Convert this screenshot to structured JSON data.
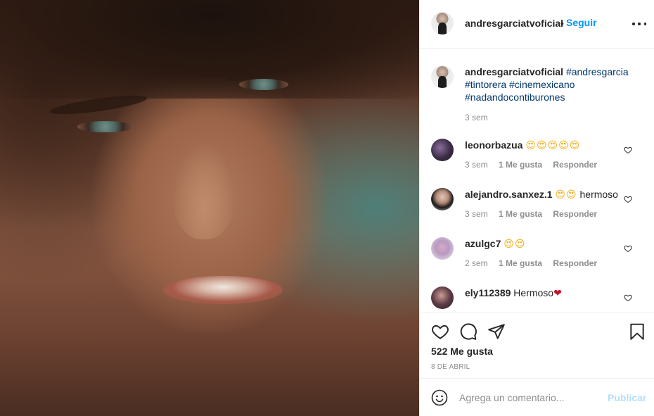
{
  "post": {
    "image_alt": "Close-up portrait of a man"
  },
  "header": {
    "username": "andresgarciatvoficial",
    "separator": "•",
    "follow_label": "Seguir"
  },
  "caption": {
    "username": "andresgarciatvoficial",
    "hashtags": [
      "#andresgarcia",
      "#tintorera",
      "#cinemexicano",
      "#nadandocontiburones"
    ],
    "time": "3 sem"
  },
  "comments": [
    {
      "username": "leonorbazua",
      "text": "",
      "emoji": "😍😍😍😍😍",
      "time": "3 sem",
      "likes": "1 Me gusta",
      "reply": "Responder"
    },
    {
      "username": "alejandro.sanxez.1",
      "text": "hermoso",
      "emoji": "😍😍",
      "time": "3 sem",
      "likes": "1 Me gusta",
      "reply": "Responder"
    },
    {
      "username": "azulgc7",
      "text": "",
      "emoji": "😍😍",
      "time": "2 sem",
      "likes": "1 Me gusta",
      "reply": "Responder"
    },
    {
      "username": "ely112389",
      "text": "Hermoso",
      "emoji": "❤",
      "time": "",
      "likes": "",
      "reply": ""
    }
  ],
  "actions": {
    "likes_count": "522 Me gusta",
    "date": "8 DE ABRIL"
  },
  "add_comment": {
    "placeholder": "Agrega un comentario...",
    "post_label": "Publicar"
  },
  "colors": {
    "link_blue": "#0095f6",
    "hashtag": "#00376b",
    "muted": "#8e8e8e",
    "post_disabled": "#b2dffc"
  }
}
